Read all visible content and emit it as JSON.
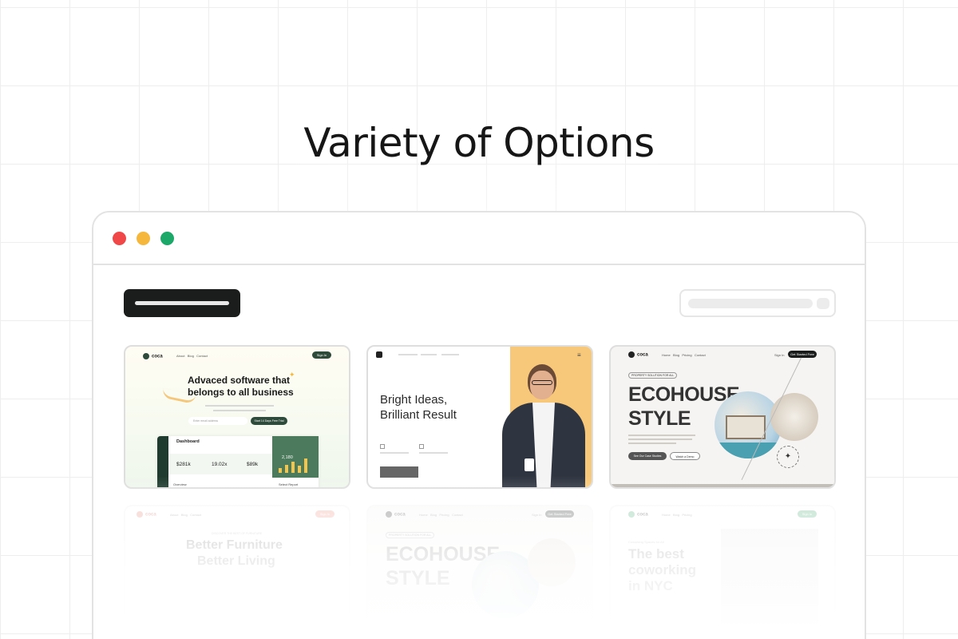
{
  "headline": "Variety of Options",
  "window": {
    "controls": [
      "close",
      "minimize",
      "maximize"
    ]
  },
  "cards": [
    {
      "logo": "coca",
      "nav": [
        "About",
        "Blog",
        "Contact"
      ],
      "cta": "Sign In",
      "title_line1": "Advaced software that",
      "title_line2": "belongs to all business",
      "email_placeholder": "Enter email address",
      "email_button": "Start 14 Days Free Trial",
      "dashboard_title": "Dashboard",
      "stats": [
        "$281k",
        "19.02x",
        "$89k"
      ],
      "highlight_value": "2,180",
      "footer_left": "Overview",
      "footer_right": "Select Report"
    },
    {
      "title_line1": "Bright Ideas,",
      "title_line2": "Brilliant Result"
    },
    {
      "logo": "coca",
      "nav": [
        "Home",
        "Blog",
        "Pricing",
        "Contact"
      ],
      "signin": "Sign In",
      "cta": "Get Started Free",
      "badge": "PROPERTY SOLUTION FOR ALL",
      "title_line1": "ECOHOUSE",
      "title_line2": "STYLE",
      "button1": "See Our Case Studies",
      "button2": "Watch a Demo"
    },
    {
      "logo": "coca",
      "nav": [
        "About",
        "Blog",
        "Contact"
      ],
      "cta": "Sign In",
      "kicker": "DISCOVER THE BEST OF FURNITURE",
      "title_line1": "Better Furniture",
      "title_line2": "Better Living"
    },
    {
      "logo": "coca",
      "nav": [
        "Home",
        "Blog",
        "Pricing",
        "Contact"
      ],
      "signin": "Sign In",
      "cta": "Get Started Free",
      "badge": "PROPERTY SOLUTION FOR ALL",
      "title_line1": "ECOHOUSE",
      "title_line2": "STYLE"
    },
    {
      "logo": "coca",
      "nav": [
        "Home",
        "Blog",
        "Pricing"
      ],
      "cta": "Sign In",
      "kicker": "Coworking Spaces for All",
      "title_line1": "The best",
      "title_line2": "coworking",
      "title_line3": "in NYC"
    }
  ],
  "colors": {
    "accent_green": "#2d4a3a",
    "yellow": "#f5c77a",
    "dot_red": "#f04848",
    "dot_yellow": "#f5b83d",
    "dot_green": "#1ba868"
  }
}
